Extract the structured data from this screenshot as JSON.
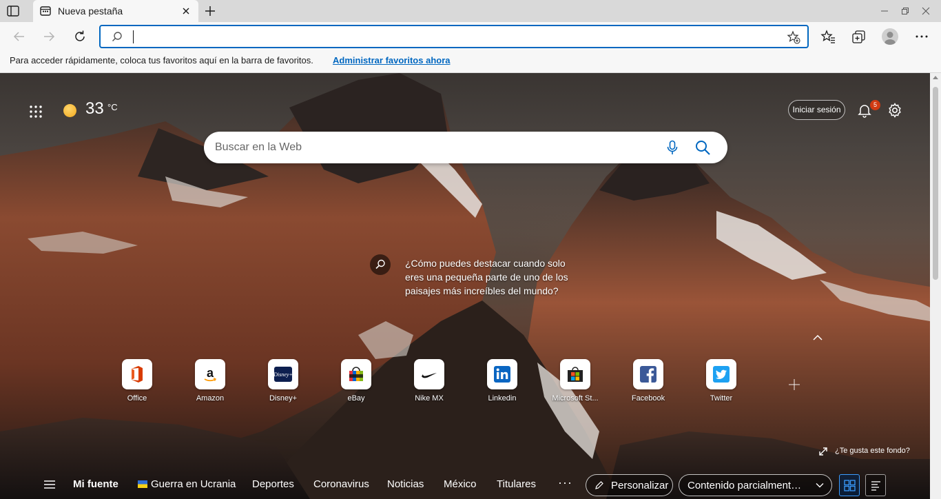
{
  "browser": {
    "tab_title": "Nueva pestaña",
    "omnibox_value": "",
    "favorites_bar": {
      "message": "Para acceder rápidamente, coloca tus favoritos aquí en la barra de favoritos.",
      "link": "Administrar favoritos ahora"
    },
    "icons": [
      "tab-actions-icon",
      "page-icon",
      "close-icon",
      "plus-icon",
      "minimize-icon",
      "maximize-icon",
      "close-window-icon",
      "back-icon",
      "forward-icon",
      "refresh-icon",
      "search-icon",
      "add-favorite-icon",
      "favorites-icon",
      "collections-icon",
      "profile-icon",
      "more-icon"
    ]
  },
  "newtab": {
    "weather": {
      "temperature": "33",
      "unit": "°C"
    },
    "signin_label": "Iniciar sesión",
    "notifications_count": "5",
    "search_placeholder": "Buscar en la Web",
    "background_info": "¿Cómo puedes destacar cuando solo eres una pequeña parte de uno de los paisajes más increíbles del mundo?",
    "tiles": [
      {
        "label": "Office",
        "icon": "office-icon"
      },
      {
        "label": "Amazon",
        "icon": "amazon-icon"
      },
      {
        "label": "Disney+",
        "icon": "disney-icon"
      },
      {
        "label": "eBay",
        "icon": "ebay-icon"
      },
      {
        "label": "Nike MX",
        "icon": "nike-icon"
      },
      {
        "label": "Linkedin",
        "icon": "linkedin-icon"
      },
      {
        "label": "Microsoft St...",
        "icon": "microsoft-store-icon"
      },
      {
        "label": "Facebook",
        "icon": "facebook-icon"
      },
      {
        "label": "Twitter",
        "icon": "twitter-icon"
      }
    ],
    "background_like": "¿Te gusta este fondo?",
    "feed_nav": {
      "items": [
        "Mi fuente",
        "Guerra en Ucrania",
        "Deportes",
        "Coronavirus",
        "Noticias",
        "México",
        "Titulares"
      ],
      "more": "···",
      "personalize": "Personalizar",
      "content_select": "Contenido parcialmente v..."
    },
    "colors": {
      "accent": "#0067c0",
      "badge": "#d13a12",
      "grid_active": "#3b9cff"
    }
  }
}
